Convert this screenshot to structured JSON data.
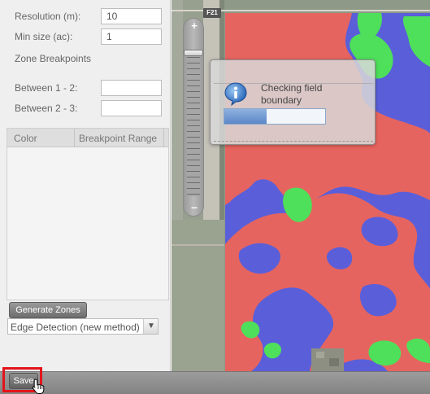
{
  "form": {
    "resolution_label": "Resolution (m):",
    "resolution_value": "10",
    "min_size_label": "Min size (ac):",
    "min_size_value": "1",
    "zone_breakpoints_title": "Zone Breakpoints",
    "between_1_2_label": "Between 1 - 2:",
    "between_1_2_value": "",
    "between_2_3_label": "Between 2 - 3:",
    "between_2_3_value": ""
  },
  "table": {
    "columns": [
      "Color",
      "Breakpoint Range"
    ],
    "rows": []
  },
  "actions": {
    "generate_label": "Generate Zones",
    "method_selected": "Edge Detection (new method)",
    "save_label": "Save"
  },
  "map": {
    "road_label": "F21",
    "zone_colors": {
      "zone_a": "#e6645f",
      "zone_b": "#5a5fd9",
      "zone_c": "#4ee05a"
    }
  },
  "dialog": {
    "message": "Checking field boundary",
    "progress_fraction": 0.42
  },
  "icons": {
    "info": "info-icon",
    "zoom_in": "plus-icon",
    "zoom_out": "minus-icon",
    "dropdown": "chevron-down-icon",
    "cursor": "hand-pointer-icon"
  }
}
